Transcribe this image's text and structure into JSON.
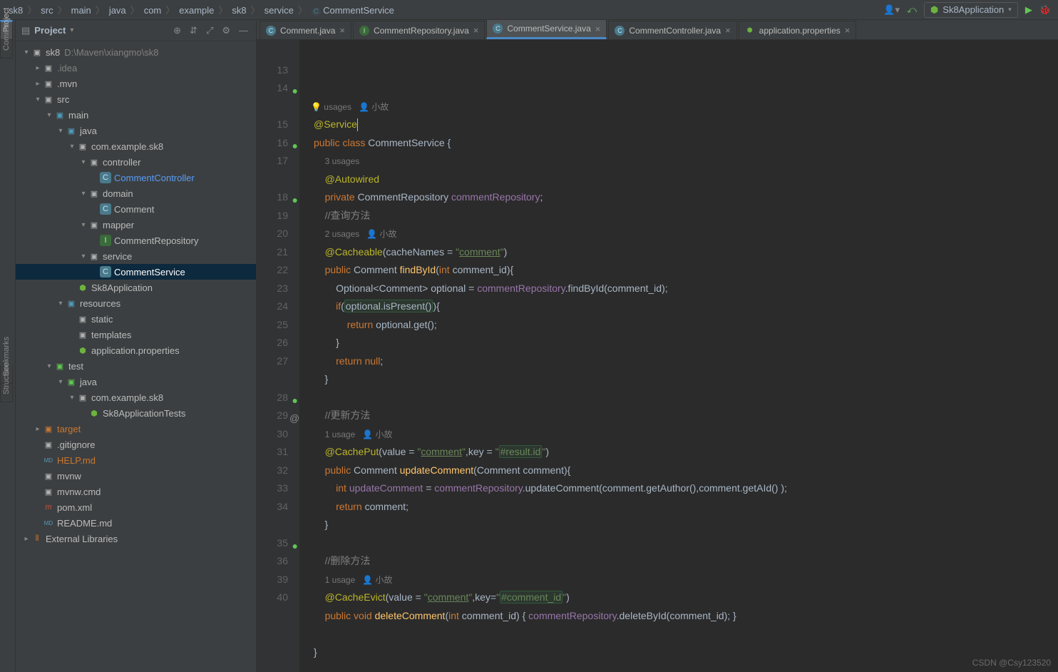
{
  "breadcrumb": [
    "sk8",
    "src",
    "main",
    "java",
    "com",
    "example",
    "sk8",
    "service",
    "CommentService"
  ],
  "runConfig": "Sk8Application",
  "panel": {
    "title": "Project"
  },
  "tree": [
    {
      "d": 0,
      "a": "open",
      "i": "module",
      "l": "sk8",
      "path": "D:\\Maven\\xiangmo\\sk8"
    },
    {
      "d": 1,
      "a": "closed",
      "i": "folder",
      "l": ".idea",
      "dim": true
    },
    {
      "d": 1,
      "a": "closed",
      "i": "folder",
      "l": ".mvn"
    },
    {
      "d": 1,
      "a": "open",
      "i": "folder",
      "l": "src"
    },
    {
      "d": 2,
      "a": "open",
      "i": "pkg-blue",
      "l": "main"
    },
    {
      "d": 3,
      "a": "open",
      "i": "pkg-blue",
      "l": "java"
    },
    {
      "d": 4,
      "a": "open",
      "i": "folder",
      "l": "com.example.sk8"
    },
    {
      "d": 5,
      "a": "open",
      "i": "folder",
      "l": "controller"
    },
    {
      "d": 6,
      "a": "none",
      "i": "class",
      "l": "CommentController",
      "blue": true
    },
    {
      "d": 5,
      "a": "open",
      "i": "folder",
      "l": "domain"
    },
    {
      "d": 6,
      "a": "none",
      "i": "class",
      "l": "Comment"
    },
    {
      "d": 5,
      "a": "open",
      "i": "folder",
      "l": "mapper"
    },
    {
      "d": 6,
      "a": "none",
      "i": "interface",
      "l": "CommentRepository"
    },
    {
      "d": 5,
      "a": "open",
      "i": "folder",
      "l": "service"
    },
    {
      "d": 6,
      "a": "none",
      "i": "class",
      "l": "CommentService",
      "sel": true
    },
    {
      "d": 4,
      "a": "none",
      "i": "spring",
      "l": "Sk8Application"
    },
    {
      "d": 3,
      "a": "open",
      "i": "pkg-blue",
      "l": "resources"
    },
    {
      "d": 4,
      "a": "none",
      "i": "folder",
      "l": "static"
    },
    {
      "d": 4,
      "a": "none",
      "i": "folder",
      "l": "templates"
    },
    {
      "d": 4,
      "a": "none",
      "i": "spring",
      "l": "application.properties"
    },
    {
      "d": 2,
      "a": "open",
      "i": "pkg-green",
      "l": "test"
    },
    {
      "d": 3,
      "a": "open",
      "i": "pkg-green",
      "l": "java"
    },
    {
      "d": 4,
      "a": "open",
      "i": "folder",
      "l": "com.example.sk8"
    },
    {
      "d": 5,
      "a": "none",
      "i": "spring",
      "l": "Sk8ApplicationTests"
    },
    {
      "d": 1,
      "a": "closed",
      "i": "orange",
      "l": "target",
      "orange": true
    },
    {
      "d": 1,
      "a": "none",
      "i": "file",
      "l": ".gitignore"
    },
    {
      "d": 1,
      "a": "none",
      "i": "md",
      "l": "HELP.md",
      "orange": true
    },
    {
      "d": 1,
      "a": "none",
      "i": "file",
      "l": "mvnw"
    },
    {
      "d": 1,
      "a": "none",
      "i": "file",
      "l": "mvnw.cmd"
    },
    {
      "d": 1,
      "a": "none",
      "i": "maven",
      "l": "pom.xml"
    },
    {
      "d": 1,
      "a": "none",
      "i": "md",
      "l": "README.md"
    },
    {
      "d": 0,
      "a": "closed",
      "i": "lib",
      "l": "External Libraries"
    }
  ],
  "tabs": [
    {
      "l": "Comment.java",
      "i": "class"
    },
    {
      "l": "CommentRepository.java",
      "i": "interface"
    },
    {
      "l": "CommentService.java",
      "i": "class",
      "active": true
    },
    {
      "l": "CommentController.java",
      "i": "class"
    },
    {
      "l": "application.properties",
      "i": "spring"
    }
  ],
  "code": {
    "hints": {
      "top": "2 usages   👤 小故",
      "u3": "3 usages",
      "u2": "2 usages   👤 小故",
      "u1": "1 usage   👤 小故",
      "u1b": "1 usage   👤 小故"
    },
    "lines": [
      {
        "n": 13,
        "html": "<span class='c-ann'>@Service</span><span class='caret'></span>"
      },
      {
        "n": 14,
        "g": "bean",
        "html": "<span class='c-kw'>public class</span> <span class='c-cls'>CommentService</span> {"
      },
      {
        "n": "",
        "html": "    <span class='hint'>3 usages</span>"
      },
      {
        "n": 15,
        "html": "    <span class='c-ann'>@Autowired</span>"
      },
      {
        "n": 16,
        "g": "bean",
        "html": "    <span class='c-kw'>private</span> <span class='c-cls'>CommentRepository</span> <span class='c-fld'>commentRepository</span>;"
      },
      {
        "n": 17,
        "html": "    <span class='c-cmt'>//查询方法</span>"
      },
      {
        "n": "",
        "html": "    <span class='hint'>2 usages   👤 小故</span>"
      },
      {
        "n": 18,
        "g": "bean",
        "html": "    <span class='c-ann'>@Cacheable</span>(<span class='c-param'>cacheNames</span> = <span class='c-str'>\"<span class='u'>comment</span>\"</span>)"
      },
      {
        "n": 19,
        "html": "    <span class='c-kw'>public</span> <span class='c-cls'>Comment</span> <span class='c-mth'>findById</span>(<span class='c-kw'>int</span> comment_id){"
      },
      {
        "n": 20,
        "html": "        <span class='c-cls'>Optional</span>&lt;<span class='c-cls'>Comment</span>&gt; optional = <span class='c-fld'>commentRepository</span>.findById(comment_id);"
      },
      {
        "n": 21,
        "html": "        <span class='c-kw'>if</span>(<span class='hl'>optional.isPresent()</span>){"
      },
      {
        "n": 22,
        "html": "            <span class='c-kw'>return</span> optional.get();"
      },
      {
        "n": 23,
        "html": "        }"
      },
      {
        "n": 24,
        "html": "        <span class='c-kw'>return null</span>;"
      },
      {
        "n": 25,
        "html": "    }"
      },
      {
        "n": 26,
        "html": ""
      },
      {
        "n": 27,
        "html": "    <span class='c-cmt'>//更新方法</span>"
      },
      {
        "n": "",
        "html": "    <span class='hint'>1 usage   👤 小故</span>"
      },
      {
        "n": 28,
        "g": "bean",
        "html": "    <span class='c-ann'>@CachePut</span>(<span class='c-param'>value</span> = <span class='c-str'>\"<span class='u'>comment</span>\"</span>,<span class='c-param'>key</span> = <span class='c-str'>\"<span class='hl'>#result.id</span>\"</span>)"
      },
      {
        "n": 29,
        "g": "at",
        "html": "    <span class='c-kw'>public</span> <span class='c-cls'>Comment</span> <span class='c-mth'>updateComment</span>(<span class='c-cls'>Comment</span> comment){"
      },
      {
        "n": 30,
        "html": "        <span class='c-kw'>int</span> <span class='c-fld'>updateComment</span> = <span class='c-fld'>commentRepository</span>.updateComment(comment.getAuthor(),comment.getAId() );"
      },
      {
        "n": 31,
        "html": "        <span class='c-kw'>return</span> comment;"
      },
      {
        "n": 32,
        "html": "    }"
      },
      {
        "n": 33,
        "html": ""
      },
      {
        "n": 34,
        "html": "    <span class='c-cmt'>//删除方法</span>"
      },
      {
        "n": "",
        "html": "    <span class='hint'>1 usage   👤 小故</span>"
      },
      {
        "n": 35,
        "g": "bean",
        "html": "    <span class='c-ann'>@CacheEvict</span>(<span class='c-param'>value</span> = <span class='c-str'>\"<span class='u'>comment</span>\"</span>,<span class='c-param'>key</span>=<span class='c-str'>\"<span class='hl'>#comment_id</span>\"</span>)"
      },
      {
        "n": 36,
        "html": "    <span class='c-kw'>public void</span> <span class='c-mth'>deleteComment</span>(<span class='c-kw'>int</span> comment_id) { <span class='c-fld'>commentRepository</span>.deleteById(comment_id); }"
      },
      {
        "n": 39,
        "html": ""
      },
      {
        "n": 40,
        "html": "}"
      }
    ]
  },
  "leftTabs": [
    "Project",
    "Commit",
    "Bookmarks",
    "Structure"
  ],
  "watermark": "CSDN @Csy123520"
}
